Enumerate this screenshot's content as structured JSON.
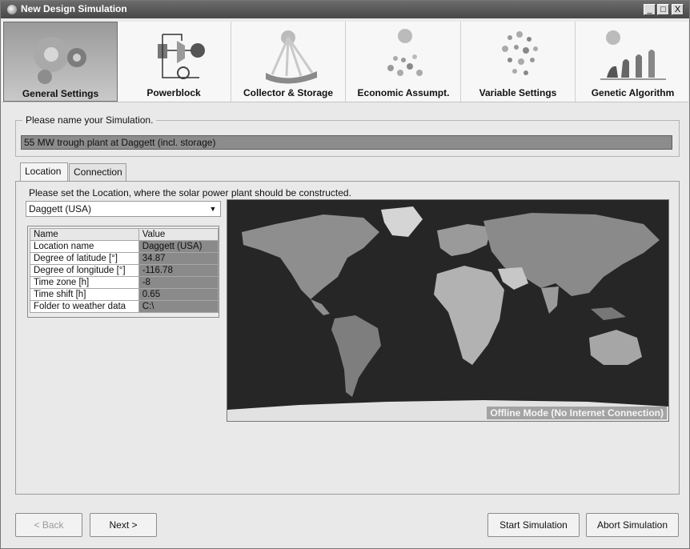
{
  "window": {
    "title": "New Design Simulation",
    "controls": [
      "_",
      "□",
      "X"
    ]
  },
  "toolbar": {
    "items": [
      {
        "label": "General Settings",
        "icon": "gears-icon",
        "active": true
      },
      {
        "label": "Powerblock",
        "icon": "powerblock-schematic-icon",
        "active": false
      },
      {
        "label": "Collector & Storage",
        "icon": "sun-collector-icon",
        "active": false
      },
      {
        "label": "Economic Assumpt.",
        "icon": "sun-coins-icon",
        "active": false
      },
      {
        "label": "Variable Settings",
        "icon": "dots-cloud-icon",
        "active": false
      },
      {
        "label": "Genetic Algorithm",
        "icon": "evolution-icon",
        "active": false
      }
    ]
  },
  "simulation": {
    "legend": "Please name your Simulation.",
    "name": "55 MW trough plant at Daggett (incl. storage)"
  },
  "tabs": [
    {
      "label": "Location",
      "active": true
    },
    {
      "label": "Connection",
      "active": false
    }
  ],
  "location": {
    "instruction": "Please set the Location, where the solar power plant should be constructed.",
    "selected": "Daggett (USA)",
    "grid": {
      "headers": [
        "Name",
        "Value"
      ],
      "rows": [
        [
          "Location name",
          "Daggett (USA)"
        ],
        [
          "Degree of latitude [°]",
          "34.87"
        ],
        [
          "Degree of longitude [°]",
          "-116.78"
        ],
        [
          "Time zone [h]",
          "-8"
        ],
        [
          "Time shift [h]",
          "0.65"
        ],
        [
          "Folder to weather data",
          "C:\\"
        ]
      ]
    },
    "map_status": "Offline Mode (No Internet Connection)"
  },
  "buttons": {
    "back": "< Back",
    "next": "Next >",
    "start": "Start Simulation",
    "abort": "Abort Simulation"
  },
  "colors": {
    "active_tool": "#9a9a9a",
    "field_bg": "#8c8c8c",
    "map_bg": "#262626"
  }
}
